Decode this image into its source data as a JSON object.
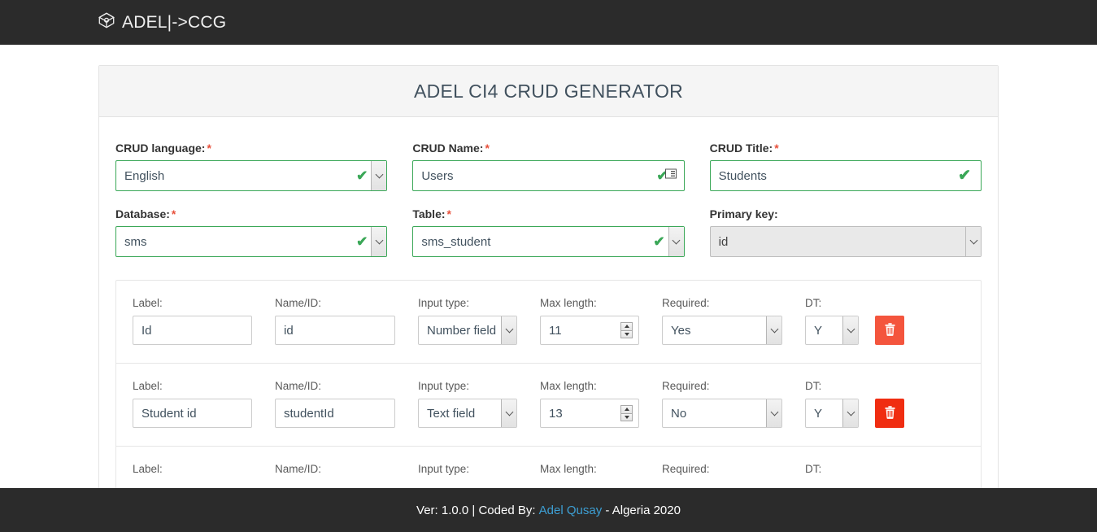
{
  "navbar": {
    "brand_text": "ADEL|->CCG",
    "brand_icon": "cube-icon"
  },
  "card": {
    "title": "ADEL CI4 CRUD GENERATOR"
  },
  "form": {
    "fields": [
      {
        "label": "CRUD language:",
        "required": true,
        "type": "select",
        "value": "English",
        "state": "valid",
        "options": [
          "English"
        ]
      },
      {
        "label": "CRUD Name:",
        "required": true,
        "type": "text",
        "value": "Users",
        "placeholder": "",
        "state": "valid",
        "icons": [
          "check-icon",
          "autofill-icon"
        ]
      },
      {
        "label": "CRUD Title:",
        "required": true,
        "type": "text",
        "value": "Students",
        "placeholder": "",
        "state": "valid",
        "icons": [
          "check-icon"
        ]
      },
      {
        "label": "Database:",
        "required": true,
        "type": "select",
        "value": "sms",
        "state": "valid",
        "options": [
          "sms"
        ]
      },
      {
        "label": "Table:",
        "required": true,
        "type": "select",
        "value": "sms_student",
        "state": "valid",
        "options": [
          "sms_student"
        ]
      },
      {
        "label": "Primary key:",
        "required": false,
        "type": "select",
        "value": "id",
        "state": "disabled",
        "options": [
          "id"
        ]
      }
    ]
  },
  "fields_panel": {
    "column_labels": {
      "label": "Label:",
      "name_id": "Name/ID:",
      "input_type": "Input type:",
      "max_length": "Max length:",
      "required": "Required:",
      "dt": "DT:"
    },
    "delete_button_icon": "trash-icon",
    "rows": [
      {
        "label": "Id",
        "name_id": "id",
        "input_type": "Number field",
        "max_length": "11",
        "required": "Yes",
        "dt": "Y",
        "delete_color": "#f4553d"
      },
      {
        "label": "Student id",
        "name_id": "studentId",
        "input_type": "Text field",
        "max_length": "13",
        "required": "No",
        "dt": "Y",
        "delete_color": "#f02d11"
      }
    ]
  },
  "footer": {
    "version_text": "Ver: 1.0.0 | Coded By:",
    "author_link": "Adel Qusay",
    "suffix_text": "- Algeria 2020"
  },
  "colors": {
    "navbar_bg": "#2b2b2b",
    "valid_border": "#3aa757",
    "required_star": "#e8513c",
    "link": "#3d9fd4",
    "card_header_bg": "#f5f5f5"
  }
}
